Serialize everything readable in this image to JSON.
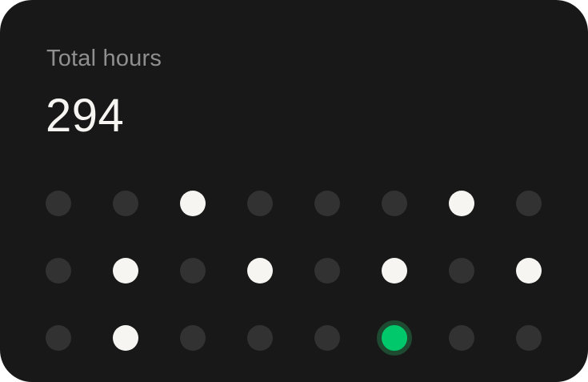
{
  "card": {
    "label": "Total hours",
    "value": "294"
  },
  "dot_grid": {
    "columns": 8,
    "rows": [
      [
        "off",
        "off",
        "on",
        "off",
        "off",
        "off",
        "on",
        "off"
      ],
      [
        "off",
        "on",
        "off",
        "on",
        "off",
        "on",
        "off",
        "on"
      ],
      [
        "off",
        "on",
        "off",
        "off",
        "off",
        "current",
        "off",
        "off"
      ]
    ]
  },
  "colors": {
    "background": "#181818",
    "label": "#8f8f8f",
    "value": "#f6f5f1",
    "dot_off": "#323232",
    "dot_on": "#f6f5f1",
    "dot_current": "#00c86b",
    "dot_current_ring": "#1e4a32"
  }
}
